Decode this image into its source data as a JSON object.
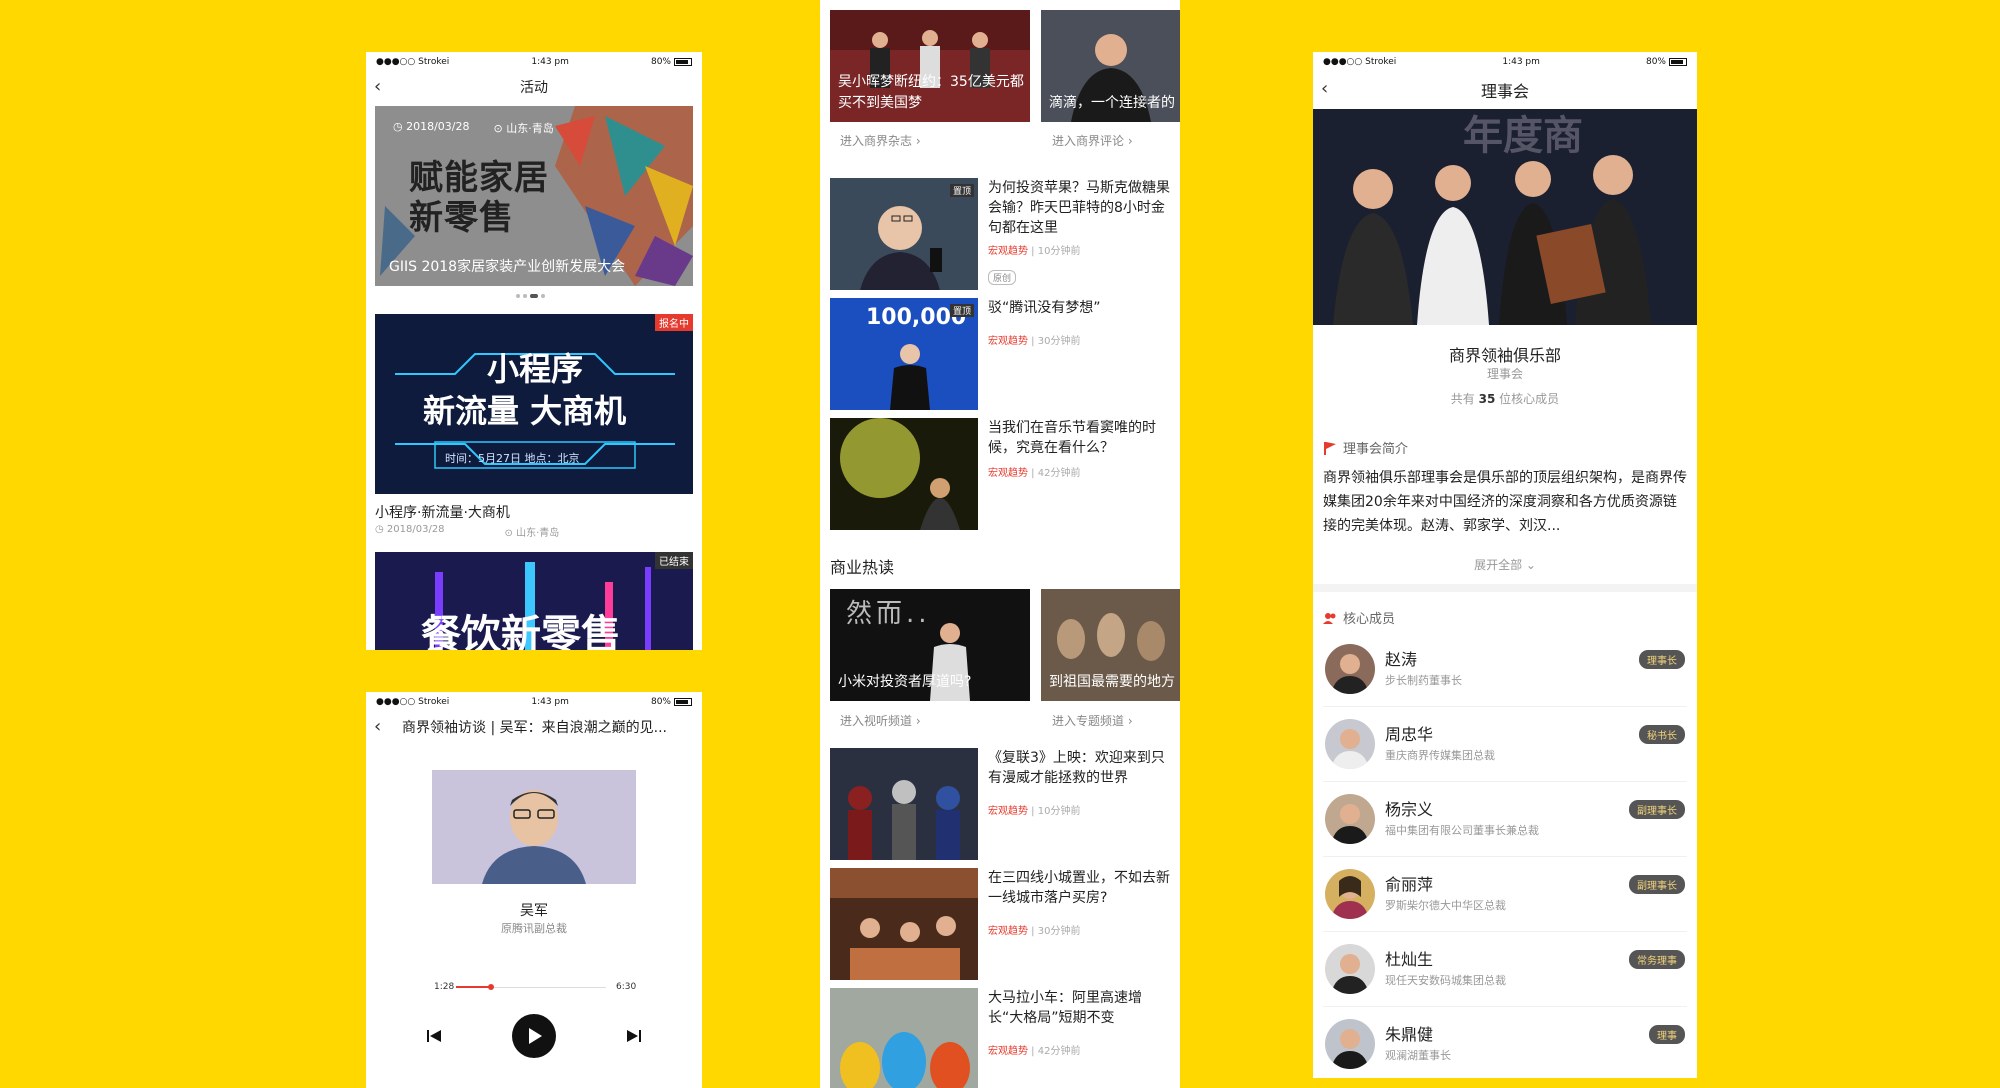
{
  "phone_activity": {
    "status": {
      "carrier": "●●●○○ Strokei",
      "time": "1:43 pm",
      "battery": "80%"
    },
    "nav_title": "活动",
    "banner": {
      "date": "2018/03/28",
      "location": "山东·青岛",
      "art_text_line1": "赋能家居",
      "art_text_line2": "新零售",
      "caption": "GIIS 2018家居家装产业创新发展大会"
    },
    "event2": {
      "badge": "报名中",
      "art_line1": "小程序",
      "art_line2": "新流量 大商机",
      "art_when": "时间：5月27日    地点：北京",
      "title": "小程序·新流量·大商机",
      "date": "2018/03/28",
      "location": "山东·青岛"
    },
    "event3": {
      "badge": "已结束",
      "art_line1": "餐饮新零售"
    }
  },
  "phone_interview": {
    "status": {
      "carrier": "●●●○○ Strokei",
      "time": "1:43 pm",
      "battery": "80%"
    },
    "nav_title": "商界领袖访谈 | 吴军：来自浪潮之巅的见...",
    "guest_name": "吴军",
    "guest_title": "原腾讯副总裁",
    "time_current": "1:28",
    "time_total": "6:30",
    "progress": 0.23
  },
  "phone_feed": {
    "top_cards": [
      {
        "caption": "吴小晖梦断纽约：35亿美元都买不到美国梦",
        "link": "进入商界杂志 ›"
      },
      {
        "caption": "滴滴，一个连接者的",
        "link": "进入商界评论 ›"
      }
    ],
    "news1": [
      {
        "title": "为何投资苹果？马斯克做糖果会输？昨天巴菲特的8小时金句都在这里",
        "tag": "宏观趋势",
        "time": "10分钟前",
        "badge": "置顶",
        "orig": "原创"
      },
      {
        "title": "驳“腾讯没有梦想”",
        "tag": "宏观趋势",
        "time": "30分钟前",
        "badge": "置顶",
        "art": "100,000"
      },
      {
        "title": "当我们在音乐节看窦唯的时候，究竟在看什么？",
        "tag": "宏观趋势",
        "time": "42分钟前"
      }
    ],
    "section_hot": "商业热读",
    "hot_cards": [
      {
        "caption": "小米对投资者厚道吗?",
        "art": "然而..",
        "link": "进入视听频道 ›"
      },
      {
        "caption": "到祖国最需要的地方",
        "link": "进入专题频道 ›"
      }
    ],
    "news2": [
      {
        "title": "《复联3》上映：欢迎来到只有漫威才能拯救的世界",
        "tag": "宏观趋势",
        "time": "10分钟前"
      },
      {
        "title": "在三四线小城置业，不如去新一线城市落户买房?",
        "tag": "宏观趋势",
        "time": "30分钟前"
      },
      {
        "title": "大马拉小车：阿里高速增长“大格局”短期不变",
        "tag": "宏观趋势",
        "time": "42分钟前"
      }
    ]
  },
  "phone_council": {
    "status": {
      "carrier": "●●●○○ Strokei",
      "time": "1:43 pm",
      "battery": "80%"
    },
    "nav_title": "理事会",
    "hero_text": "年度商",
    "club_name": "商界领袖俱乐部",
    "club_sub": "理事会",
    "count_pre": "共有",
    "count_num": "35",
    "count_post": "位核心成员",
    "intro_heading": "理事会简介",
    "intro_text": "商界领袖俱乐部理事会是俱乐部的顶层组织架构，是商界传媒集团20余年来对中国经济的深度洞察和各方优质资源链接的完美体现。赵涛、郭家学、刘汉...",
    "expand": "展开全部 ⌄",
    "members_heading": "核心成员",
    "members": [
      {
        "name": "赵涛",
        "desc": "步长制药董事长",
        "role": "理事长"
      },
      {
        "name": "周忠华",
        "desc": "重庆商界传媒集团总裁",
        "role": "秘书长"
      },
      {
        "name": "杨宗义",
        "desc": "福中集团有限公司董事长兼总裁",
        "role": "副理事长"
      },
      {
        "name": "俞丽萍",
        "desc": "罗斯柴尔德大中华区总裁",
        "role": "副理事长"
      },
      {
        "name": "杜灿生",
        "desc": "现任天安数码城集团总裁",
        "role": "常务理事"
      },
      {
        "name": "朱鼎健",
        "desc": "观澜湖董事长",
        "role": "理事"
      }
    ]
  },
  "colors": {
    "background": "#FFD800",
    "accent_red": "#e63a2e"
  }
}
